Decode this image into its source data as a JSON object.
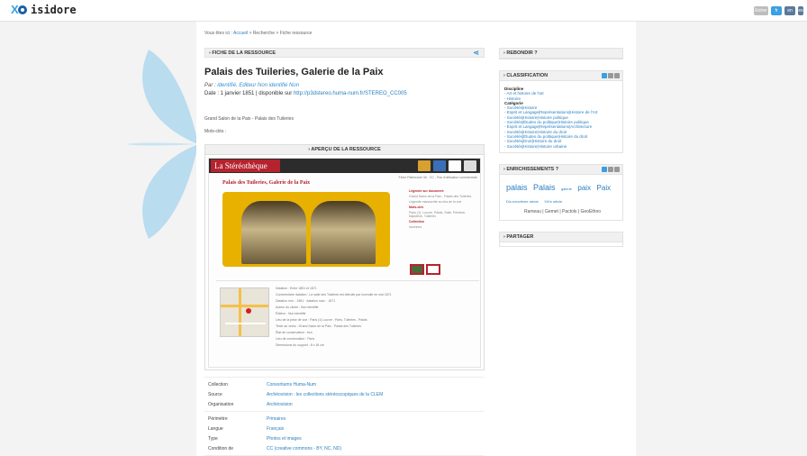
{
  "app": {
    "name": "isidore"
  },
  "topbar": {
    "buttons": [
      {
        "label": "Entrer",
        "color": "#bdbdbd",
        "w": 16
      },
      {
        "label": "fr",
        "color": "#3aa0e0",
        "w": 12
      },
      {
        "label": "en",
        "color": "#5b7a9a",
        "w": 12
      },
      {
        "label": "es",
        "color": "#5b7a9a",
        "w": 6
      }
    ]
  },
  "breadcrumb": {
    "prefix": "Vous êtes ici :",
    "home": "Accueil",
    "sep": ">",
    "search": "Recherche",
    "current": "Fiche ressource"
  },
  "fiche": {
    "header": "› FICHE DE LA RESSOURCE",
    "title": "Palais des Tuileries, Galerie de la Paix",
    "authors_label": "Par :",
    "authors": "identifié, Editeur Non identifié Non",
    "date_label": "Date : 1 janvier 1851 | disponible sur",
    "url": "http://p3dstereo.huma-num.fr/STEREO_CC005",
    "description": "Grand Salon de la Paix - Palais des Tuileries",
    "keywords_label": "Mots-clés :"
  },
  "apercu": {
    "header": "› APERÇU DE LA RESSOURCE",
    "brand": "La Stéréothèque",
    "subline": "Fiche Patrimoine 36 - CC - Pas d'utilisation commerciale",
    "title": "Palais des Tuileries, Galerie de la Paix",
    "side": [
      {
        "text": "Légende sur document",
        "red": true
      },
      {
        "text": "Grand Salon de la Paix - Palais des Tuileries",
        "red": false
      },
      {
        "text": "Légende manuscrite au dos de la vue",
        "red": false
      },
      {
        "text": "Mots-clés",
        "red": true
      },
      {
        "text": "Paris (1), Louvre, Palais, Salle, Peinture, Napoléon, Tuileries",
        "red": false
      },
      {
        "text": "Collection",
        "red": true
      },
      {
        "text": "Inconnus",
        "red": false
      }
    ],
    "meta_lines": [
      "Datation : Entre 1851 et 1871",
      "Commentaire datation : La salle des Tuileries est détruite par incendie en mai 1871",
      "Datation min. : 1851 · datation max. : 1871",
      "Auteur du cliché : Non identifié",
      "Éditeur : Non identifié",
      "Lieu de la prise de vue : Paris (1) Louvre ; Paris, Tuileries - Palais",
      "Texte au verso : Grand Salon de la Paix - Palais des Tuileries",
      "État de conservation : bon",
      "Lieu de conservation : Paris",
      "Dimensions du support : 8 x 18 cm"
    ]
  },
  "info_groups": [
    [
      {
        "key": "Collection",
        "value": "Consortiums Huma-Num"
      },
      {
        "key": "Source",
        "value": "Archéovision : les collections stéréoscopiques de la CLEM"
      },
      {
        "key": "Organisation",
        "value": "Archéovision"
      }
    ],
    [
      {
        "key": "Périmètre",
        "value": "Primaires"
      },
      {
        "key": "Langue",
        "value": "Français"
      },
      {
        "key": "Type",
        "value": "Photos et images"
      },
      {
        "key": "Condition de",
        "value": "CC (creative commons - BY, NC, ND)"
      }
    ]
  ],
  "rebondir": {
    "header": "› REBONDIR ?"
  },
  "classification": {
    "header": "› CLASSIFICATION",
    "items": [
      {
        "text": "Discipline",
        "head": true
      },
      {
        "text": "- Art et histoire de l'art",
        "head": false
      },
      {
        "text": "- Histoire",
        "head": false
      },
      {
        "text": "Catégorie",
        "head": true
      },
      {
        "text": "- Sociétés|Histoire",
        "head": false
      },
      {
        "text": "- Esprit et Langage|Représentations|Histoire de l'Art",
        "head": false
      },
      {
        "text": "- Sociétés|Histoire|Histoire politique",
        "head": false
      },
      {
        "text": "- Sociétés|Études du politique|Histoire politique",
        "head": false
      },
      {
        "text": "- Esprit et Langage|Représentations|Architecture",
        "head": false
      },
      {
        "text": "- Sociétés|Histoire|Histoire du droit",
        "head": false
      },
      {
        "text": "- Sociétés|Études du politique|Histoire du droit",
        "head": false
      },
      {
        "text": "- Sociétés|Droit|Histoire du droit",
        "head": false
      },
      {
        "text": "- Sociétés|Histoire|Histoire urbaine",
        "head": false
      }
    ]
  },
  "enrichissements": {
    "header": "› ENRICHISSEMENTS ?",
    "tags": [
      {
        "text": "palais",
        "size": 9
      },
      {
        "text": "Palais",
        "size": 9
      },
      {
        "text": "galerie",
        "size": 4
      },
      {
        "text": "paix",
        "size": 8
      },
      {
        "text": "Paix",
        "size": 8
      },
      {
        "text": "Dix-neuvième siècle",
        "size": 4
      },
      {
        "text": "XIXe siècle",
        "size": 4
      }
    ],
    "links": "Rameau | Gemet | Pactols | GeoEthno"
  },
  "partager": {
    "header": "› PARTAGER"
  },
  "colors": {
    "accent": "#2a7fc0",
    "brand_red": "#b5232e",
    "flower": "#b9dcef"
  }
}
